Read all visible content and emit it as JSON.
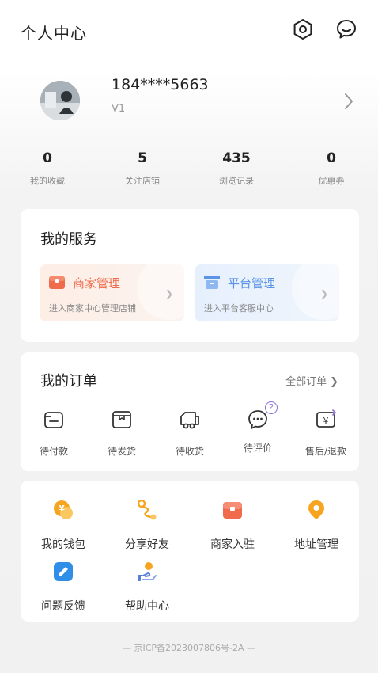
{
  "header": {
    "title": "个人中心",
    "settings_icon": "settings-icon",
    "chat_icon": "customer-service-icon"
  },
  "profile": {
    "phone": "184****5663",
    "level": "V1"
  },
  "stats": [
    {
      "value": "0",
      "label": "我的收藏"
    },
    {
      "value": "5",
      "label": "关注店铺"
    },
    {
      "value": "435",
      "label": "浏览记录"
    },
    {
      "value": "0",
      "label": "优惠券"
    }
  ],
  "services": {
    "title": "我的服务",
    "merchant": {
      "name": "商家管理",
      "sub": "进入商家中心管理店铺"
    },
    "platform": {
      "name": "平台管理",
      "sub": "进入平台客服中心"
    }
  },
  "orders": {
    "title": "我的订单",
    "all_label": "全部订单",
    "items": [
      {
        "label": "待付款",
        "icon": "wallet-icon"
      },
      {
        "label": "待发货",
        "icon": "box-icon"
      },
      {
        "label": "待收货",
        "icon": "truck-icon"
      },
      {
        "label": "待评价",
        "icon": "comment-icon",
        "badge": "2"
      },
      {
        "label": "售后/退款",
        "icon": "refund-icon"
      }
    ]
  },
  "tools": [
    {
      "label": "我的钱包",
      "icon": "wallet-coin-icon"
    },
    {
      "label": "分享好友",
      "icon": "share-icon"
    },
    {
      "label": "商家入驻",
      "icon": "merchant-entry-icon"
    },
    {
      "label": "地址管理",
      "icon": "location-icon"
    },
    {
      "label": "问题反馈",
      "icon": "feedback-icon"
    },
    {
      "label": "帮助中心",
      "icon": "help-icon"
    }
  ],
  "footer": {
    "icp": "— 京ICP备2023007806号-2A —"
  },
  "colors": {
    "merchant_accent": "#f06b4b",
    "platform_accent": "#5b94e6",
    "badge_color": "#8a6fd8"
  }
}
